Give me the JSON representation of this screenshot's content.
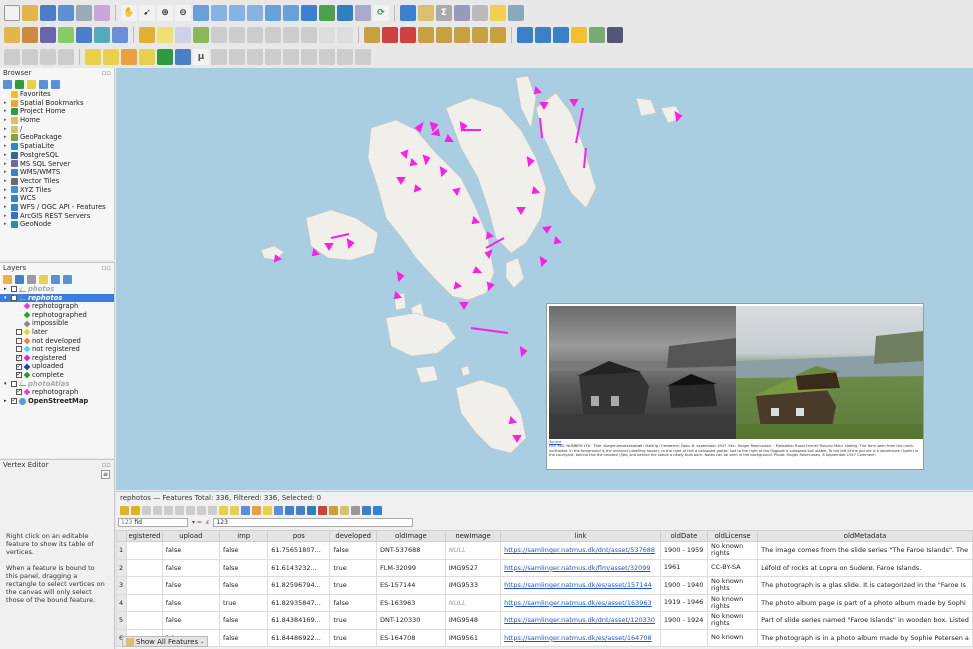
{
  "panels": {
    "browser": {
      "title": "Browser"
    },
    "layers": {
      "title": "Layers"
    },
    "vertex": {
      "title": "Vertex Editor",
      "help1": "Right click on an editable feature to show its table of vertices.",
      "help2": "When a feature is bound to this panel, dragging a rectangle to select vertices on the canvas will only select those of the bound feature."
    }
  },
  "browser_items": [
    {
      "label": "Favorites",
      "icon": "star-icon",
      "color": "#f0c020"
    },
    {
      "label": "Spatial Bookmarks",
      "icon": "bookmark-icon",
      "color": "#e8a33b"
    },
    {
      "label": "Project Home",
      "icon": "project-home-icon",
      "color": "#2e9c3e"
    },
    {
      "label": "Home",
      "icon": "home-folder-icon",
      "color": "#d8c070"
    },
    {
      "label": "/",
      "icon": "root-folder-icon",
      "color": "#d8c070"
    },
    {
      "label": "GeoPackage",
      "icon": "geopackage-icon",
      "color": "#7aa63a"
    },
    {
      "label": "SpatiaLite",
      "icon": "spatialite-icon",
      "color": "#3b83c8"
    },
    {
      "label": "PostgreSQL",
      "icon": "postgresql-icon",
      "color": "#336791"
    },
    {
      "label": "MS SQL Server",
      "icon": "mssql-icon",
      "color": "#6c6c9c"
    },
    {
      "label": "WMS/WMTS",
      "icon": "wms-icon",
      "color": "#3a82c4"
    },
    {
      "label": "Vector Tiles",
      "icon": "vector-tiles-icon",
      "color": "#6a6a6a"
    },
    {
      "label": "XYZ Tiles",
      "icon": "xyz-tiles-icon",
      "color": "#4b8bd0"
    },
    {
      "label": "WCS",
      "icon": "wcs-icon",
      "color": "#3a82c4"
    },
    {
      "label": "WFS / OGC API - Features",
      "icon": "wfs-icon",
      "color": "#3a82c4"
    },
    {
      "label": "ArcGIS REST Servers",
      "icon": "arcgis-icon",
      "color": "#3a6ec4"
    },
    {
      "label": "GeoNode",
      "icon": "geonode-icon",
      "color": "#2a8ab8"
    }
  ],
  "layers_items": [
    {
      "label": "photos",
      "level": 0,
      "checked": false,
      "italic": true,
      "bold": true,
      "color": "#aaa",
      "sym": "none"
    },
    {
      "label": "rephotos",
      "level": 0,
      "checked": true,
      "italic": true,
      "bold": true,
      "color": "#fff",
      "sym": "none",
      "selected": true
    },
    {
      "label": "rephotograph",
      "level": 2,
      "checked": null,
      "sym": "#e040e0"
    },
    {
      "label": "rephotographed",
      "level": 2,
      "checked": null,
      "sym": "#33a02c"
    },
    {
      "label": "impossible",
      "level": 2,
      "checked": null,
      "sym": "#888"
    },
    {
      "label": "later",
      "level": 2,
      "checked": false,
      "sym": "#f0d020"
    },
    {
      "label": "not developed",
      "level": 2,
      "checked": false,
      "sym": "#f08030"
    },
    {
      "label": "not registered",
      "level": 2,
      "checked": false,
      "sym": "#40e0e0"
    },
    {
      "label": "registered",
      "level": 2,
      "checked": true,
      "sym": "#e020e0"
    },
    {
      "label": "uploaded",
      "level": 2,
      "checked": true,
      "sym": "#2040c0"
    },
    {
      "label": "complete",
      "level": 2,
      "checked": true,
      "sym": "#20a020"
    },
    {
      "label": "photoAtlas",
      "level": 0,
      "checked": false,
      "italic": true,
      "bold": true,
      "color": "#aaa",
      "sym": "none"
    },
    {
      "label": "rephotograph",
      "level": 2,
      "checked": true,
      "sym": "#e040e0"
    },
    {
      "label": "OpenStreetMap",
      "level": 0,
      "checked": true,
      "bold": true,
      "sym": "osm"
    }
  ],
  "popup": {
    "link_text": "Source",
    "caption": "FID: 365, NUMBER:176 · Title: Kongshamsbakkatrøð i Hattrig i Færøerne; Dato: 6. september 1947. Est.: Holger Rasmussen. · Metadata: Raoul farmer Mouritz Mohr. Hattrig. The farm seen from the north-northwest. In the foreground is the unthinet (dwelling house); to the right of this a collapsed grotto; just to the right of the flagpole a collapsed bull stable. To the left of the picture is a storehouse (hjallir) in the courtyard, behind this the smoked (fjós) and behind the stable a newly built barn. Notes can be seen in the background. Photo: Holger Rasmussen, 6 September 1947 Comment:"
  },
  "attribute_table": {
    "title": "rephotos — Features Total: 336, Filtered: 336, Selected: 0",
    "field_select": "fid",
    "expression": "123",
    "columns": [
      "",
      "egistered",
      "upload",
      "imp",
      "pos",
      "developed",
      "oldImage",
      "newImage",
      "link",
      "oldDate",
      "oldLicense",
      "oldMetadata"
    ],
    "rows": [
      [
        "1",
        "",
        "false",
        "false",
        "61.75651807...",
        "false",
        "DNT-537688",
        "NULL",
        "https://samlinger.natmus.dk/dnt/asset/537688",
        "1900 - 1959",
        "No known rights",
        "The image comes from the slide series \"The Faroe Islands\". The"
      ],
      [
        "2",
        "",
        "false",
        "false",
        "61.6143232...",
        "true",
        "FLM-32099",
        "IMG9527",
        "https://samlinger.natmus.dk/flm/asset/32099",
        "1961",
        "CC-BY-SA",
        "Léfold of rocks at Lopra on Suderø, Faroe Islands."
      ],
      [
        "3",
        "",
        "false",
        "false",
        "61.82596794...",
        "true",
        "ES-157144",
        "IMG9533",
        "https://samlinger.natmus.dk/es/asset/157144",
        "1900 - 1940",
        "No known rights",
        "The photograph is a glas slide. It is categorized in the \"Faroe Is"
      ],
      [
        "4",
        "",
        "false",
        "true",
        "61.82935847...",
        "false",
        "ES-163963",
        "NULL",
        "https://samlinger.natmus.dk/es/asset/163963",
        "1919 - 1946",
        "No known rights",
        "The photo album page is part of a photo album made by Sophi"
      ],
      [
        "5",
        "",
        "false",
        "false",
        "61.84384169...",
        "true",
        "DNT-120330",
        "IMG9548",
        "https://samlinger.natmus.dk/dnt/asset/120330",
        "1900 - 1924",
        "No known rights",
        "Part of slide series named \"Faroe Islands\" in wooden box. Listed"
      ],
      [
        "6",
        "",
        "false",
        "false",
        "61.84486922...",
        "true",
        "ES-164708",
        "IMG9561",
        "https://samlinger.natmus.dk/es/asset/164708",
        "",
        "No known",
        "The photograph is in a photo album made by Sophie Petersen a"
      ]
    ],
    "show_all_label": "Show All Features"
  },
  "colors": {
    "sea": "#a9cde1",
    "land": "#f0efe9",
    "marker": "#ff1ee8",
    "selection": "#3b7ddd"
  }
}
